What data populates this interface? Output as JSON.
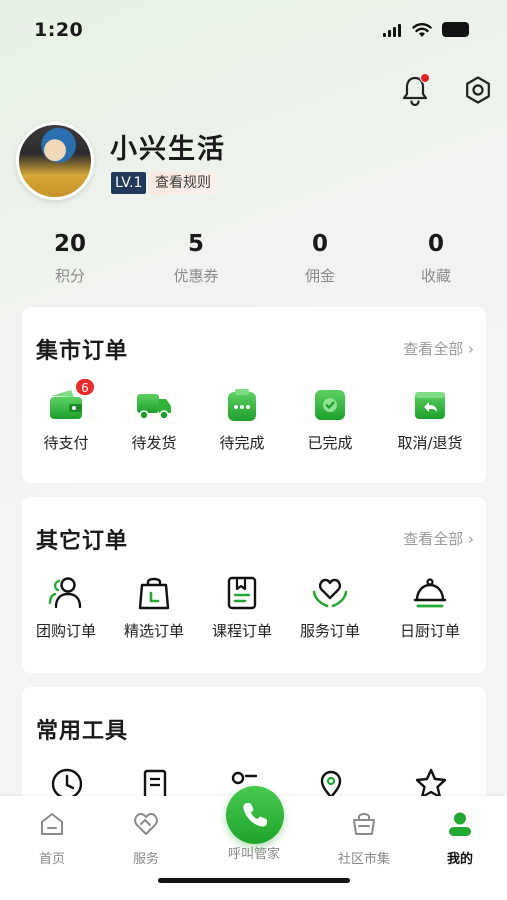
{
  "status_bar": {
    "time": "1:20"
  },
  "profile": {
    "name": "小兴生活",
    "level": "LV.1",
    "rules_label": "查看规则"
  },
  "stats": [
    {
      "value": "20",
      "label": "积分"
    },
    {
      "value": "5",
      "label": "优惠券"
    },
    {
      "value": "0",
      "label": "佣金"
    },
    {
      "value": "0",
      "label": "收藏"
    }
  ],
  "market_orders": {
    "title": "集市订单",
    "view_all": "查看全部",
    "items": [
      {
        "label": "待支付",
        "badge": "6",
        "icon": "wallet-icon"
      },
      {
        "label": "待发货",
        "icon": "truck-icon"
      },
      {
        "label": "待完成",
        "icon": "clipboard-icon"
      },
      {
        "label": "已完成",
        "icon": "check-icon"
      },
      {
        "label": "取消/退货",
        "icon": "return-icon"
      }
    ]
  },
  "other_orders": {
    "title": "其它订单",
    "view_all": "查看全部",
    "items": [
      {
        "label": "团购订单",
        "icon": "group-icon"
      },
      {
        "label": "精选订单",
        "icon": "shopping-bag-icon"
      },
      {
        "label": "课程订单",
        "icon": "book-icon"
      },
      {
        "label": "服务订单",
        "icon": "heart-hands-icon"
      },
      {
        "label": "日厨订单",
        "icon": "cloche-icon"
      }
    ]
  },
  "tools": {
    "title": "常用工具"
  },
  "tab_bar": {
    "items": [
      {
        "label": "首页",
        "icon": "home-icon"
      },
      {
        "label": "服务",
        "icon": "handshake-icon"
      },
      {
        "label": "呼叫管家",
        "icon": "phone-icon"
      },
      {
        "label": "社区市集",
        "icon": "basket-icon"
      },
      {
        "label": "我的",
        "icon": "user-icon",
        "active": true
      }
    ]
  },
  "colors": {
    "brand_green": "#22a833",
    "badge_red": "#ee2b2b",
    "level_navy": "#213a5c"
  }
}
